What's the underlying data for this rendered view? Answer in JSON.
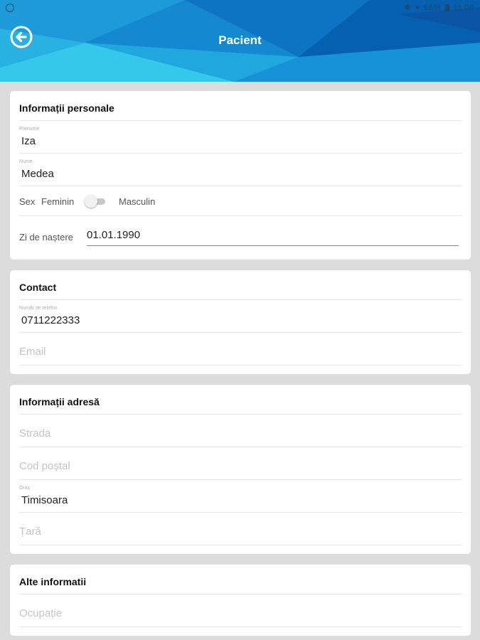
{
  "header": {
    "title": "Pacient",
    "back_icon": "back-arrow-circle-icon",
    "status_bar": {
      "battery_text": "98%",
      "time": "11:06"
    }
  },
  "personal": {
    "title": "Informații personale",
    "first_name": {
      "caption": "Prenume",
      "value": "Iza"
    },
    "last_name": {
      "caption": "Nume",
      "value": "Medea"
    },
    "sex": {
      "label": "Sex",
      "option_left": "Feminin",
      "option_right": "Masculin",
      "selected": "Feminin"
    },
    "birth_date": {
      "label": "Zi de naștere",
      "value": "01.01.1990"
    }
  },
  "contact": {
    "title": "Contact",
    "phone": {
      "caption": "Număr de telefon",
      "value": "0711222333"
    },
    "email": {
      "placeholder": "Email"
    }
  },
  "address": {
    "title": "Informații adresă",
    "street": {
      "placeholder": "Strada"
    },
    "postal_code": {
      "placeholder": "Cod poștal"
    },
    "city": {
      "caption": "Oraș",
      "value": "Timisoara"
    },
    "country": {
      "placeholder": "Țară"
    }
  },
  "other": {
    "title": "Alte informatii",
    "occupation": {
      "placeholder": "Ocupație"
    }
  },
  "colors": {
    "header_primary": "#0b78c7",
    "header_light": "#29c0e6",
    "background": "#dcdcdc",
    "card": "#ffffff"
  }
}
